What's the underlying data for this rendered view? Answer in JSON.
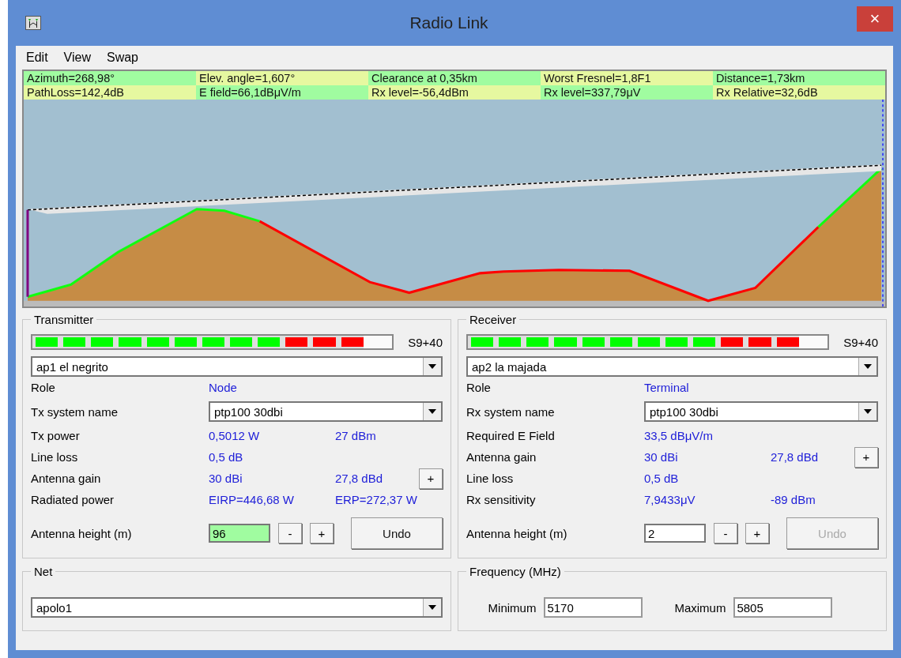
{
  "window": {
    "title": "Radio Link",
    "close": "×"
  },
  "menu": [
    "Edit",
    "View",
    "Swap"
  ],
  "info": [
    [
      "Azimuth=268,98°",
      "Elev. angle=1,607°",
      "Clearance at 0,35km",
      "Worst Fresnel=1,8F1",
      "Distance=1,73km"
    ],
    [
      "PathLoss=142,4dB",
      "E field=66,1dBμV/m",
      "Rx level=-56,4dBm",
      "Rx level=337,79μV",
      "Rx Relative=32,6dB"
    ]
  ],
  "panels": [
    {
      "title": "Transmitter",
      "meter": {
        "level": 0.92,
        "reading": "S9+40"
      },
      "unit": "ap1 el negrito",
      "rows": [
        {
          "kind": "value",
          "label": "Role",
          "value": "Node"
        },
        {
          "kind": "select",
          "label": "Tx system name",
          "value": "ptp100 30dbi"
        },
        {
          "kind": "value",
          "label": "Tx power",
          "value": "0,5012 W",
          "value2": "27 dBm"
        },
        {
          "kind": "value",
          "label": "Line loss",
          "value": "0,5 dB"
        },
        {
          "kind": "value",
          "label": "Antenna gain",
          "value": "30 dBi",
          "value2": "27,8 dBd",
          "button": "+"
        },
        {
          "kind": "value",
          "label": "Radiated power",
          "value": "EIRP=446,68 W",
          "value2": "ERP=272,37 W"
        }
      ],
      "height": {
        "label": "Antenna height (m)",
        "value": "96",
        "highlighted": true,
        "minus": "-",
        "plus": "+",
        "undo": "Undo",
        "undo_disabled": false
      }
    },
    {
      "title": "Receiver",
      "meter": {
        "level": 0.92,
        "reading": "S9+40"
      },
      "unit": "ap2 la majada",
      "rows": [
        {
          "kind": "value",
          "label": "Role",
          "value": "Terminal"
        },
        {
          "kind": "select",
          "label": "Rx system name",
          "value": "ptp100 30dbi"
        },
        {
          "kind": "value",
          "label": "Required E Field",
          "value": "33,5 dBμV/m"
        },
        {
          "kind": "value",
          "label": "Antenna gain",
          "value": "30 dBi",
          "value2": "27,8 dBd",
          "button": "+"
        },
        {
          "kind": "value",
          "label": "Line loss",
          "value": "0,5 dB"
        },
        {
          "kind": "value",
          "label": "Rx sensitivity",
          "value": "7,9433μV",
          "value2": "-89 dBm"
        }
      ],
      "height": {
        "label": "Antenna height (m)",
        "value": "2",
        "highlighted": false,
        "minus": "-",
        "plus": "+",
        "undo": "Undo",
        "undo_disabled": true
      }
    }
  ],
  "net": {
    "title": "Net",
    "value": "apolo1"
  },
  "frequency": {
    "title": "Frequency (MHz)",
    "minimum_label": "Minimum",
    "minimum": "5170",
    "maximum_label": "Maximum",
    "maximum": "5805"
  }
}
